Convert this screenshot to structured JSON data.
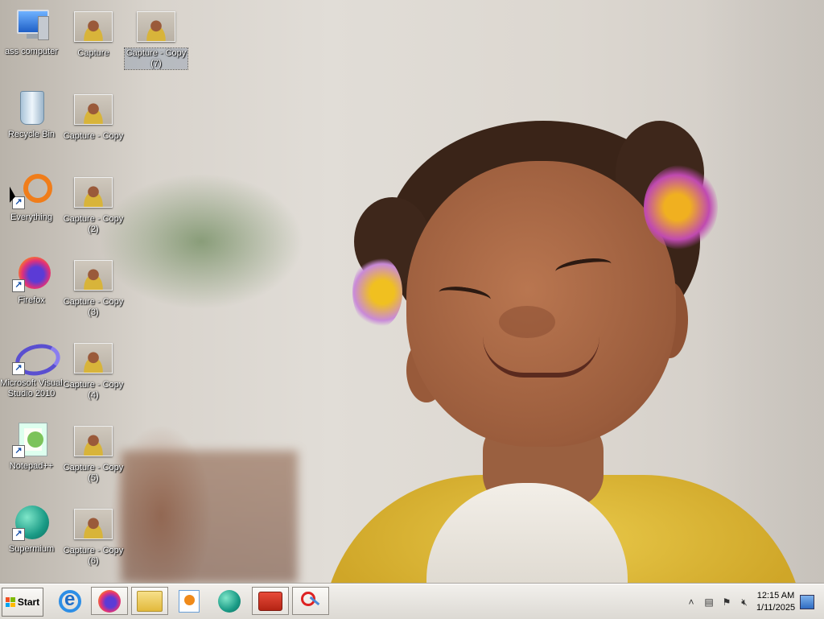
{
  "desktop": {
    "icons": [
      {
        "label": "ass computer",
        "icon": "computer-icon"
      },
      {
        "label": "Recycle Bin",
        "icon": "recycle-bin-icon"
      },
      {
        "label": "Everything",
        "icon": "everything-search-icon"
      },
      {
        "label": "Firefox",
        "icon": "firefox-icon"
      },
      {
        "label": "Microsoft Visual Studio 2010",
        "icon": "visual-studio-icon"
      },
      {
        "label": "Notepad++",
        "icon": "notepad-plus-plus-icon"
      },
      {
        "label": "Supermium",
        "icon": "supermium-icon"
      },
      {
        "label": "Capture",
        "icon": "image-file-icon"
      },
      {
        "label": "Capture - Copy",
        "icon": "image-file-icon"
      },
      {
        "label": "Capture - Copy (2)",
        "icon": "image-file-icon"
      },
      {
        "label": "Capture - Copy (3)",
        "icon": "image-file-icon"
      },
      {
        "label": "Capture - Copy (4)",
        "icon": "image-file-icon"
      },
      {
        "label": "Capture - Copy (5)",
        "icon": "image-file-icon"
      },
      {
        "label": "Capture - Copy (6)",
        "icon": "image-file-icon"
      },
      {
        "label": "Capture - Copy (7)",
        "icon": "image-file-icon"
      }
    ]
  },
  "taskbar": {
    "start_label": "Start",
    "pinned": [
      {
        "icon": "internet-explorer-icon"
      },
      {
        "icon": "firefox-icon"
      },
      {
        "icon": "file-explorer-icon"
      },
      {
        "icon": "media-player-icon"
      },
      {
        "icon": "supermium-icon"
      },
      {
        "icon": "toolbox-icon"
      },
      {
        "icon": "snipping-tool-icon"
      }
    ],
    "tray": {
      "show_hidden_glyph": "˄",
      "network_icon": "network-icon",
      "action_center_icon": "flag-icon",
      "volume_icon": "volume-muted-icon",
      "time": "12:15 AM",
      "date": "1/11/2025"
    }
  },
  "colors": {
    "taskbar_bg": "#e6e3de",
    "icon_label_text": "#ffffff"
  }
}
